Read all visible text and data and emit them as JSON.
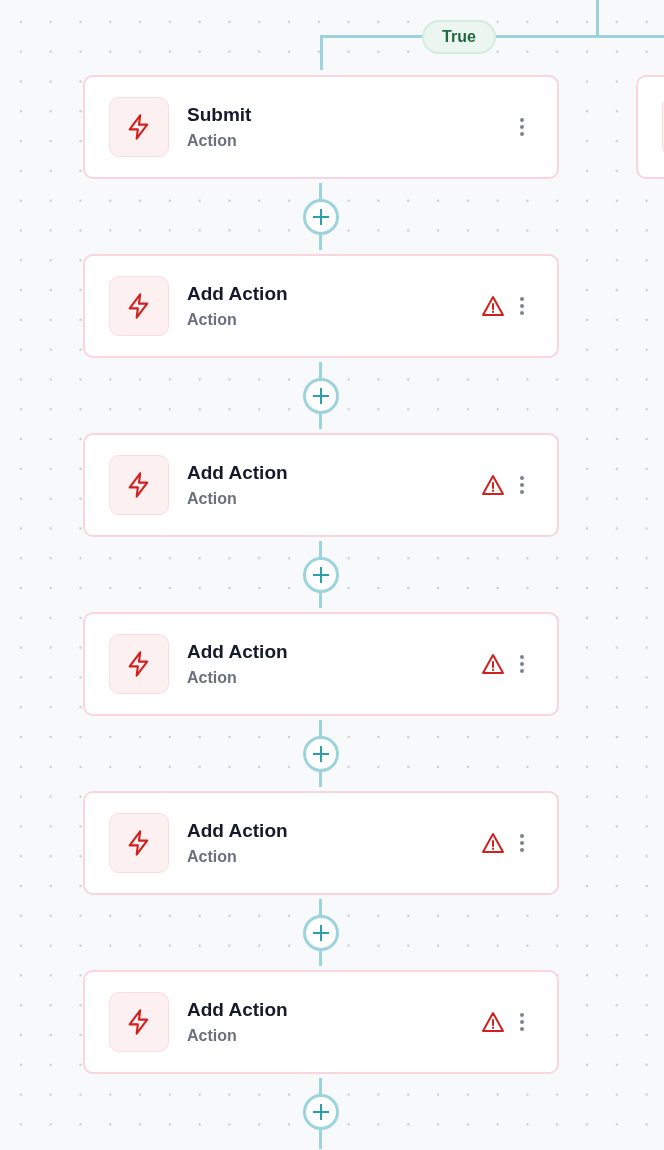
{
  "branch": {
    "label": "True"
  },
  "nodes": [
    {
      "title": "Submit",
      "subtitle": "Action",
      "warning": false
    },
    {
      "title": "Add Action",
      "subtitle": "Action",
      "warning": true
    },
    {
      "title": "Add Action",
      "subtitle": "Action",
      "warning": true
    },
    {
      "title": "Add Action",
      "subtitle": "Action",
      "warning": true
    },
    {
      "title": "Add Action",
      "subtitle": "Action",
      "warning": true
    },
    {
      "title": "Add Action",
      "subtitle": "Action",
      "warning": true
    }
  ]
}
